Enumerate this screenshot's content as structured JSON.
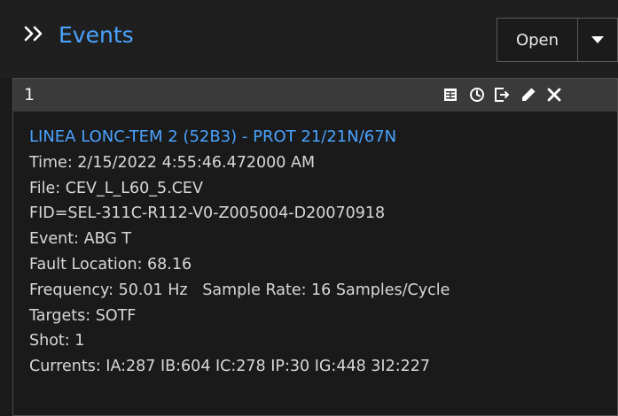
{
  "header": {
    "title": "Events",
    "open_label": "Open"
  },
  "card": {
    "number": "1",
    "tools": [
      "table-icon",
      "clock-icon",
      "export-icon",
      "edit-icon",
      "close-icon"
    ],
    "heading": "LINEA LONC-TEM 2 (52B3) - PROT 21/21N/67N",
    "lines": [
      "Time:  2/15/2022 4:55:46.472000 AM",
      "File: CEV_L_L60_5.CEV",
      "FID=SEL-311C-R112-V0-Z005004-D20070918",
      "Event: ABG T",
      "Fault Location: 68.16",
      "Frequency: 50.01 Hz   Sample Rate: 16 Samples/Cycle",
      "Targets: SOTF",
      "Shot: 1",
      "Currents: IA:287 IB:604 IC:278 IP:30 IG:448 3I2:227"
    ]
  },
  "colors": {
    "accent": "#4aa3ff",
    "background": "#1b1b1b",
    "card_bar": "#3a3a3a",
    "text": "#d8d8d8"
  }
}
